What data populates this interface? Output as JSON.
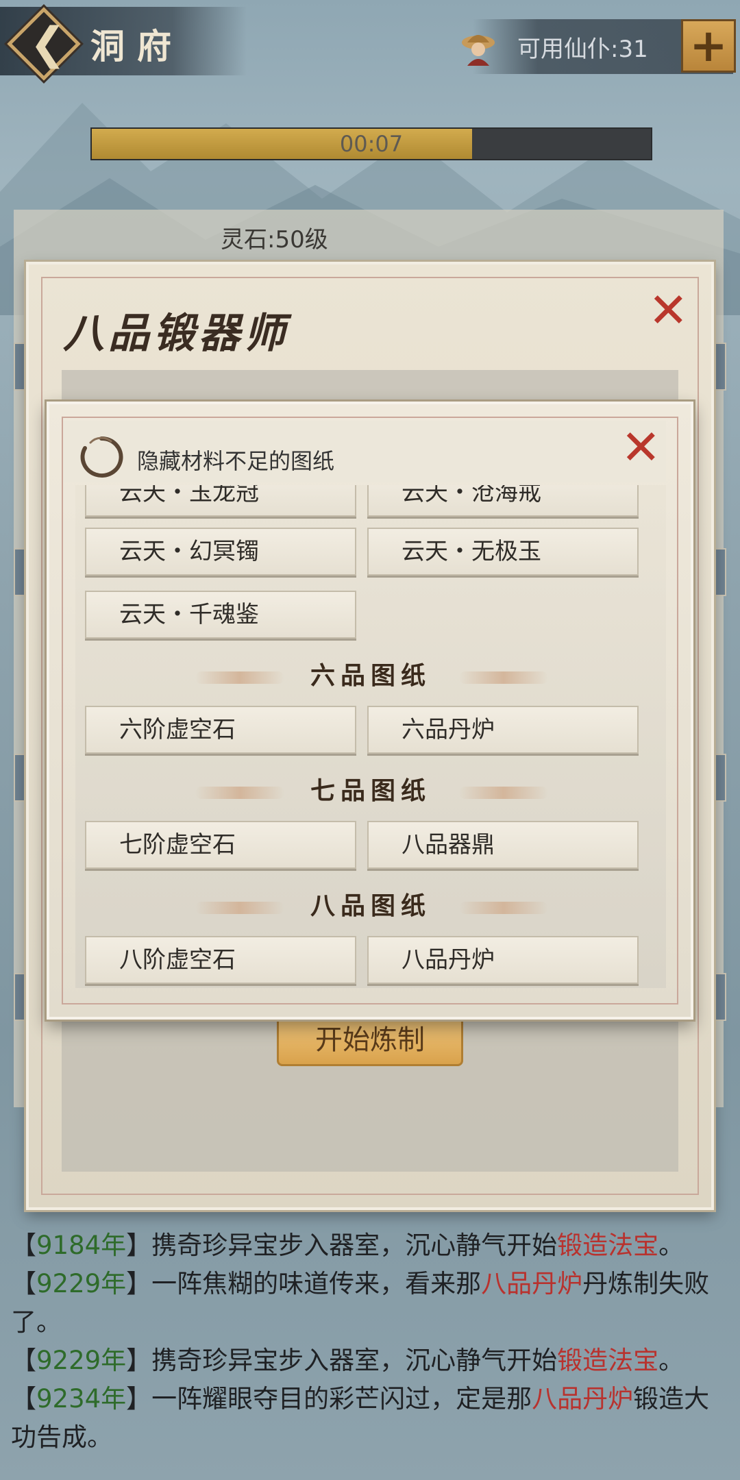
{
  "header": {
    "title": "洞府",
    "servants_label": "可用仙仆:31",
    "plus_label": "+"
  },
  "progress": {
    "time_text": "00:07",
    "fraction": 0.68
  },
  "under_panel": {
    "lingshi_label": "灵石:50级"
  },
  "forge_dialog": {
    "title": "八品锻器师",
    "start_button": "开始炼制"
  },
  "blueprint_dialog": {
    "hide_option_label": "隐藏材料不足的图纸",
    "top_items": [
      "云天・玉龙冠",
      "云天・沧海戒",
      "云天・幻冥镯",
      "云天・无极玉",
      "云天・千魂鉴"
    ],
    "sections": [
      {
        "title": "六品图纸",
        "items": [
          "六阶虚空石",
          "六品丹炉"
        ]
      },
      {
        "title": "七品图纸",
        "items": [
          "七阶虚空石",
          "八品器鼎"
        ]
      },
      {
        "title": "八品图纸",
        "items": [
          "八阶虚空石",
          "八品丹炉"
        ]
      }
    ]
  },
  "log": [
    {
      "year": "9184年",
      "a": "携奇珍异宝步入器室，沉心静气开始",
      "hl": "锻造法宝",
      "b": "。"
    },
    {
      "year": "9229年",
      "a": "一阵焦糊的味道传来，看来那",
      "hl": "八品丹炉",
      "b": "丹炼制失败了。"
    },
    {
      "year": "9229年",
      "a": "携奇珍异宝步入器室，沉心静气开始",
      "hl": "锻造法宝",
      "b": "。"
    },
    {
      "year": "9234年",
      "a": "一阵耀眼夺目的彩芒闪过，定是那",
      "hl": "八品丹炉",
      "b": "锻造大功告成。"
    }
  ],
  "colors": {
    "year_green": "#2e6b2a",
    "highlight_red": "#b8322e",
    "close_red": "#b9372c",
    "gold": "#c9a56a"
  },
  "icons": [
    "back-arrow-icon",
    "servant-hat-icon",
    "plus-icon",
    "close-icon",
    "check-ring-icon"
  ]
}
